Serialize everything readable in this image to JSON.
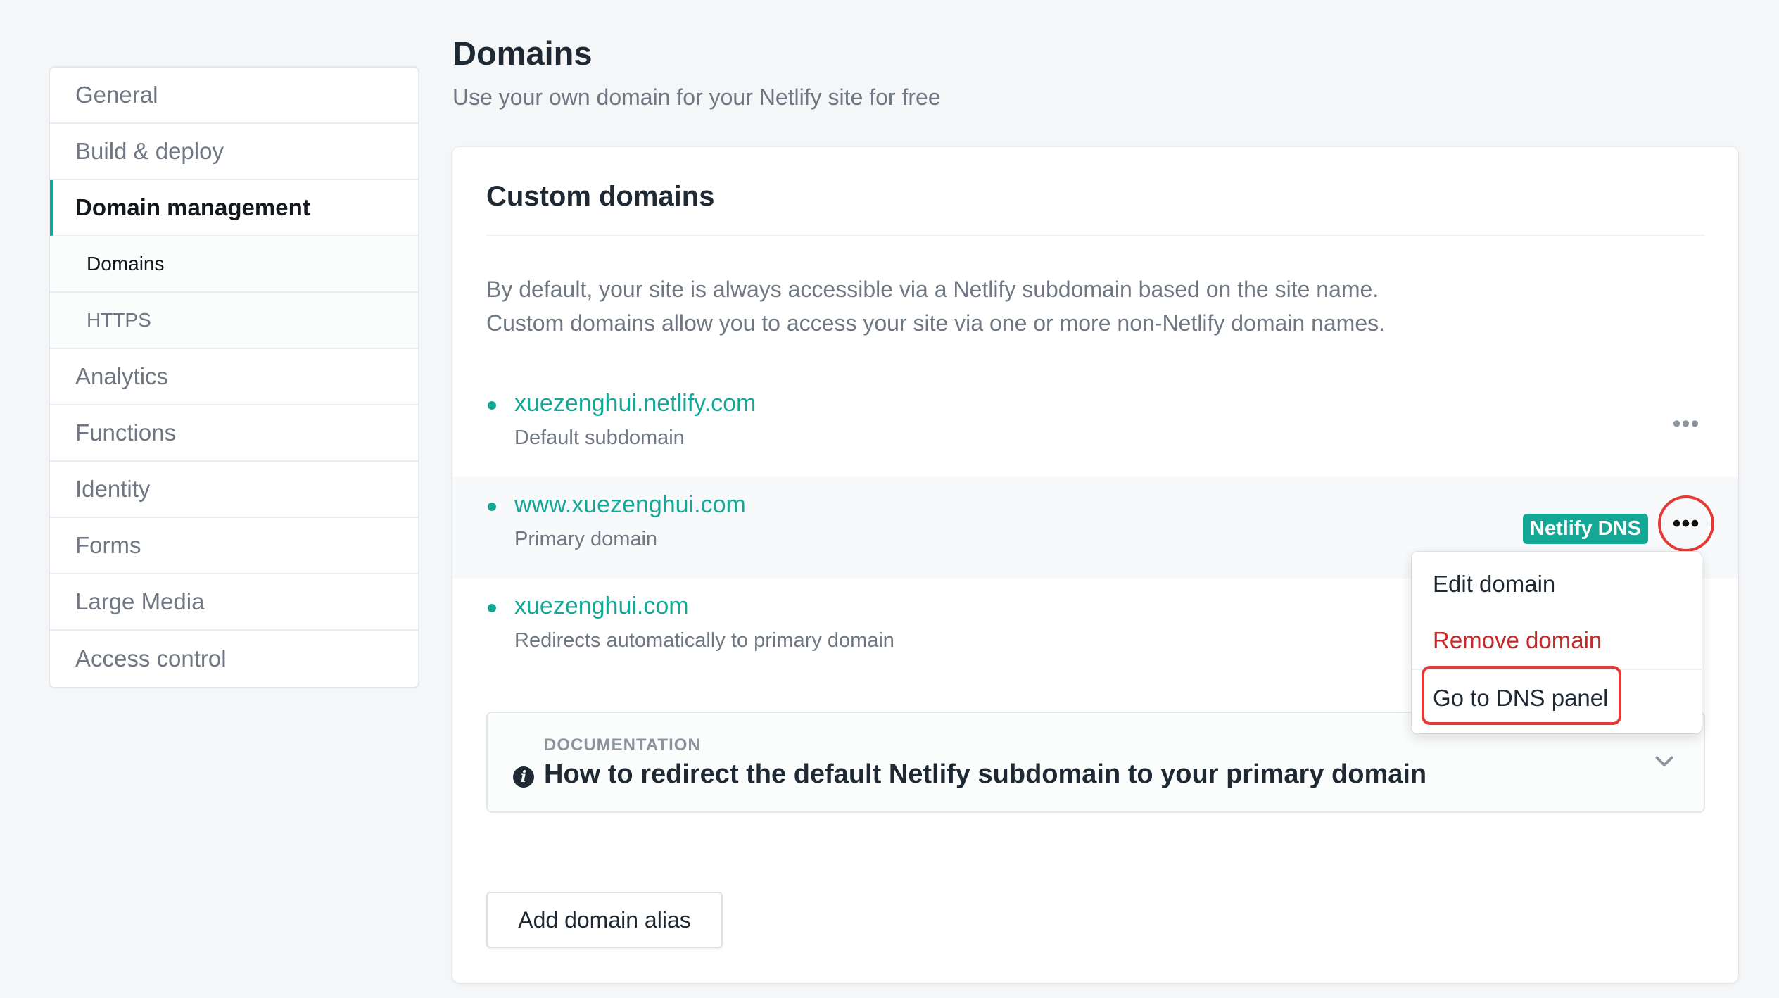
{
  "sidebar": {
    "items": [
      {
        "label": "General"
      },
      {
        "label": "Build & deploy"
      },
      {
        "label": "Domain management"
      },
      {
        "label": "Domains"
      },
      {
        "label": "HTTPS"
      },
      {
        "label": "Analytics"
      },
      {
        "label": "Functions"
      },
      {
        "label": "Identity"
      },
      {
        "label": "Forms"
      },
      {
        "label": "Large Media"
      },
      {
        "label": "Access control"
      }
    ]
  },
  "header": {
    "title": "Domains",
    "subtitle": "Use your own domain for your Netlify site for free"
  },
  "card": {
    "title": "Custom domains",
    "desc_line1": "By default, your site is always accessible via a Netlify subdomain based on the site name.",
    "desc_line2": "Custom domains allow you to access your site via one or more non-Netlify domain names.",
    "domains": [
      {
        "name": "xuezenghui.netlify.com",
        "note": "Default subdomain"
      },
      {
        "name": "www.xuezenghui.com",
        "note": "Primary domain",
        "badge": "Netlify DNS"
      },
      {
        "name": "xuezenghui.com",
        "note": "Redirects automatically to primary domain"
      }
    ],
    "more_glyph": "•••",
    "doc": {
      "label": "DOCUMENTATION",
      "title": "How to redirect the default Netlify subdomain to your primary domain",
      "info_glyph": "i"
    },
    "add_button": "Add domain alias"
  },
  "menu": {
    "edit": "Edit domain",
    "remove": "Remove domain",
    "dns": "Go to DNS panel"
  },
  "colors": {
    "accent": "#15a796",
    "danger": "#c62828",
    "highlight_ring": "#e53935"
  }
}
